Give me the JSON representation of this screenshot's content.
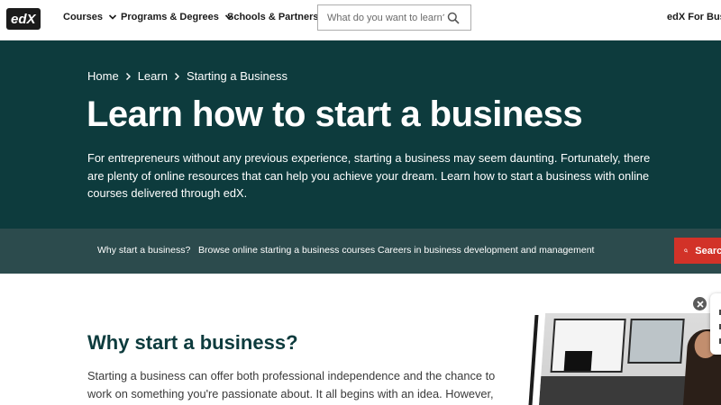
{
  "header": {
    "logo_text": "edX",
    "nav": [
      {
        "label": "Courses",
        "has_dropdown": true
      },
      {
        "label": "Programs & Degrees",
        "has_dropdown": true
      },
      {
        "label": "Schools & Partners",
        "has_dropdown": false
      }
    ],
    "search": {
      "placeholder": "What do you want to learn?",
      "value": "",
      "icon": "search-icon"
    },
    "business_link": "edX For Business"
  },
  "hero": {
    "breadcrumb": [
      "Home",
      "Learn",
      "Starting a Business"
    ],
    "title": "Learn how to start a business",
    "description": "For entrepreneurs without any previous experience, starting a business may seem daunting. Fortunately, there are plenty of online resources that can help you achieve your dream. Learn how to start a business with online courses delivered through edX."
  },
  "subnav": {
    "links": [
      "Why start a business?",
      "Browse online starting a business courses",
      "Careers in business development and management"
    ],
    "search_button": "Search"
  },
  "section": {
    "heading": "Why start a business?",
    "body": "Starting a business can offer both professional independence and the chance to work on something you're passionate about. It all begins with an idea. However,"
  },
  "colors": {
    "hero_bg": "#0d3b3d",
    "subnav_bg": "#2c4b4d",
    "accent_red": "#d23228",
    "heading_teal": "#0d3b3d"
  }
}
